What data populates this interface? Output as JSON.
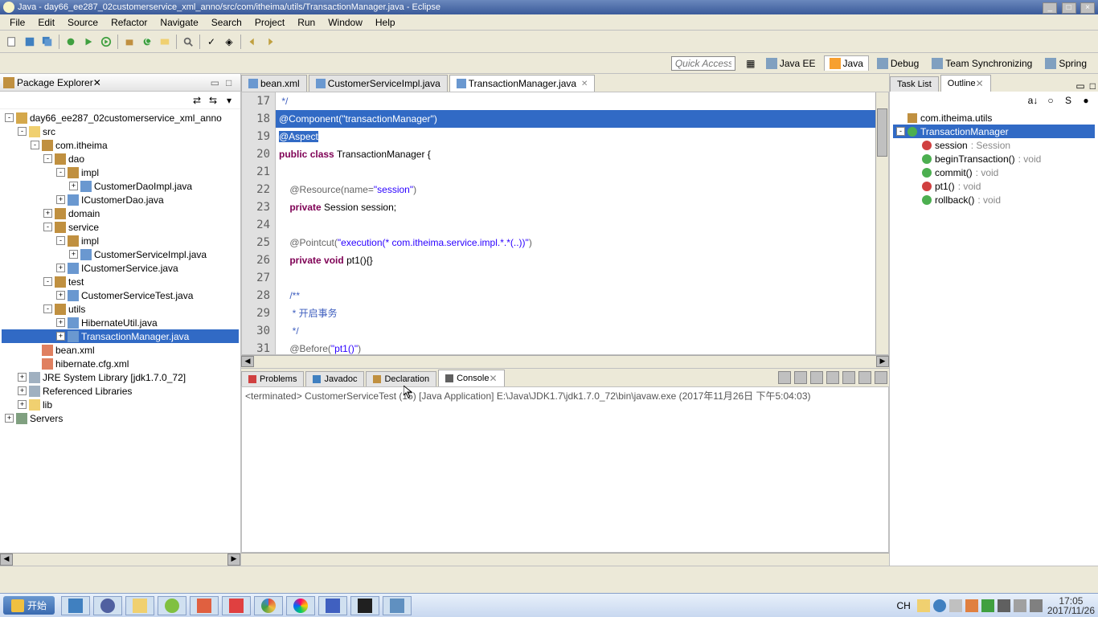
{
  "window": {
    "title": "Java - day66_ee287_02customerservice_xml_anno/src/com/itheima/utils/TransactionManager.java - Eclipse",
    "minimize": "_",
    "maximize": "□",
    "close": "×"
  },
  "menu": [
    "File",
    "Edit",
    "Source",
    "Refactor",
    "Navigate",
    "Search",
    "Project",
    "Run",
    "Window",
    "Help"
  ],
  "quickaccess": "Quick Access",
  "perspectives": [
    {
      "label": "Java EE",
      "active": false
    },
    {
      "label": "Java",
      "active": true
    },
    {
      "label": "Debug",
      "active": false
    },
    {
      "label": "Team Synchronizing",
      "active": false
    },
    {
      "label": "Spring",
      "active": false
    }
  ],
  "packageExplorer": {
    "title": "Package Explorer",
    "tree": [
      {
        "ind": 0,
        "tg": "-",
        "ic": "ic-proj",
        "lbl": "day66_ee287_02customerservice_xml_anno"
      },
      {
        "ind": 1,
        "tg": "-",
        "ic": "ic-folder",
        "lbl": "src"
      },
      {
        "ind": 2,
        "tg": "-",
        "ic": "ic-pkg",
        "lbl": "com.itheima"
      },
      {
        "ind": 3,
        "tg": "-",
        "ic": "ic-pkg",
        "lbl": "dao"
      },
      {
        "ind": 4,
        "tg": "-",
        "ic": "ic-pkg",
        "lbl": "impl"
      },
      {
        "ind": 5,
        "tg": "+",
        "ic": "ic-java",
        "lbl": "CustomerDaoImpl.java"
      },
      {
        "ind": 4,
        "tg": "+",
        "ic": "ic-java",
        "lbl": "ICustomerDao.java"
      },
      {
        "ind": 3,
        "tg": "+",
        "ic": "ic-pkg",
        "lbl": "domain"
      },
      {
        "ind": 3,
        "tg": "-",
        "ic": "ic-pkg",
        "lbl": "service"
      },
      {
        "ind": 4,
        "tg": "-",
        "ic": "ic-pkg",
        "lbl": "impl"
      },
      {
        "ind": 5,
        "tg": "+",
        "ic": "ic-java",
        "lbl": "CustomerServiceImpl.java"
      },
      {
        "ind": 4,
        "tg": "+",
        "ic": "ic-java",
        "lbl": "ICustomerService.java"
      },
      {
        "ind": 3,
        "tg": "-",
        "ic": "ic-pkg",
        "lbl": "test"
      },
      {
        "ind": 4,
        "tg": "+",
        "ic": "ic-java",
        "lbl": "CustomerServiceTest.java"
      },
      {
        "ind": 3,
        "tg": "-",
        "ic": "ic-pkg",
        "lbl": "utils"
      },
      {
        "ind": 4,
        "tg": "+",
        "ic": "ic-java",
        "lbl": "HibernateUtil.java"
      },
      {
        "ind": 4,
        "tg": "+",
        "ic": "ic-java",
        "lbl": "TransactionManager.java",
        "sel": true
      },
      {
        "ind": 2,
        "tg": " ",
        "ic": "ic-xml",
        "lbl": "bean.xml"
      },
      {
        "ind": 2,
        "tg": " ",
        "ic": "ic-xml",
        "lbl": "hibernate.cfg.xml"
      },
      {
        "ind": 1,
        "tg": "+",
        "ic": "ic-lib",
        "lbl": "JRE System Library [jdk1.7.0_72]"
      },
      {
        "ind": 1,
        "tg": "+",
        "ic": "ic-lib",
        "lbl": "Referenced Libraries"
      },
      {
        "ind": 1,
        "tg": "+",
        "ic": "ic-folder",
        "lbl": "lib"
      },
      {
        "ind": 0,
        "tg": "+",
        "ic": "ic-srv",
        "lbl": "Servers"
      }
    ]
  },
  "editorTabs": [
    {
      "label": "bean.xml",
      "active": false
    },
    {
      "label": "CustomerServiceImpl.java",
      "active": false
    },
    {
      "label": "TransactionManager.java",
      "active": true
    }
  ],
  "code": {
    "startLine": 17,
    "lines": [
      {
        "n": 17,
        "html": "<span class='k-com'> */</span>"
      },
      {
        "n": 18,
        "html": "<span class='k-ann'>@Component(</span><span class='k-str'>\"transactionManager\"</span><span class='k-ann'>)</span>",
        "sel": true
      },
      {
        "n": 19,
        "html": "<span class='k-ann'>@Aspect</span>",
        "sel": true,
        "partial": true
      },
      {
        "n": 20,
        "html": "<span class='k-kw'>public</span> <span class='k-kw'>class</span> <span class='k-norm'>TransactionManager {</span>"
      },
      {
        "n": 21,
        "html": ""
      },
      {
        "n": 22,
        "html": "    <span class='k-ann'>@Resource(name=</span><span class='k-str'>\"session\"</span><span class='k-ann'>)</span>"
      },
      {
        "n": 23,
        "html": "    <span class='k-kw'>private</span> <span class='k-norm'>Session session;</span>"
      },
      {
        "n": 24,
        "html": ""
      },
      {
        "n": 25,
        "html": "    <span class='k-ann'>@Pointcut(</span><span class='k-str'>\"execution(* com.itheima.service.impl.*.*(..))\"</span><span class='k-ann'>)</span>"
      },
      {
        "n": 26,
        "html": "    <span class='k-kw'>private</span> <span class='k-kw'>void</span> <span class='k-norm'>pt1(){}</span>"
      },
      {
        "n": 27,
        "html": ""
      },
      {
        "n": 28,
        "html": "    <span class='k-com'>/**</span>"
      },
      {
        "n": 29,
        "html": "    <span class='k-com'> * 开启事务</span>"
      },
      {
        "n": 30,
        "html": "    <span class='k-com'> */</span>"
      },
      {
        "n": 31,
        "html": "    <span class='k-ann'>@Before(</span><span class='k-str'>\"pt1()\"</span><span class='k-ann'>)</span>"
      }
    ]
  },
  "bottomTabs": [
    {
      "label": "Problems",
      "icon": "#d04040"
    },
    {
      "label": "Javadoc",
      "icon": "#4080c0"
    },
    {
      "label": "Declaration",
      "icon": "#c09040"
    },
    {
      "label": "Console",
      "icon": "#606060",
      "active": true
    }
  ],
  "consoleLine": "<terminated> CustomerServiceTest (15) [Java Application] E:\\Java\\JDK1.7\\jdk1.7.0_72\\bin\\javaw.exe (2017年11月26日 下午5:04:03)",
  "outlineTabs": [
    {
      "label": "Task List",
      "active": false
    },
    {
      "label": "Outline",
      "active": true
    }
  ],
  "outline": [
    {
      "ind": 0,
      "tg": " ",
      "ic": "ol-pkg",
      "lbl": "com.itheima.utils"
    },
    {
      "ind": 0,
      "tg": "-",
      "ic": "ol-class",
      "lbl": "TransactionManager",
      "sel": true
    },
    {
      "ind": 1,
      "tg": " ",
      "ic": "ol-priv",
      "lbl": "session",
      "sig": ": Session"
    },
    {
      "ind": 1,
      "tg": " ",
      "ic": "ol-pub",
      "lbl": "beginTransaction()",
      "sig": ": void"
    },
    {
      "ind": 1,
      "tg": " ",
      "ic": "ol-pub",
      "lbl": "commit()",
      "sig": ": void"
    },
    {
      "ind": 1,
      "tg": " ",
      "ic": "ol-priv",
      "lbl": "pt1()",
      "sig": ": void"
    },
    {
      "ind": 1,
      "tg": " ",
      "ic": "ol-pub",
      "lbl": "rollback()",
      "sig": ": void"
    }
  ],
  "taskbar": {
    "start": "开始",
    "ime": "CH",
    "time": "17:05",
    "date": "2017/11/26"
  }
}
